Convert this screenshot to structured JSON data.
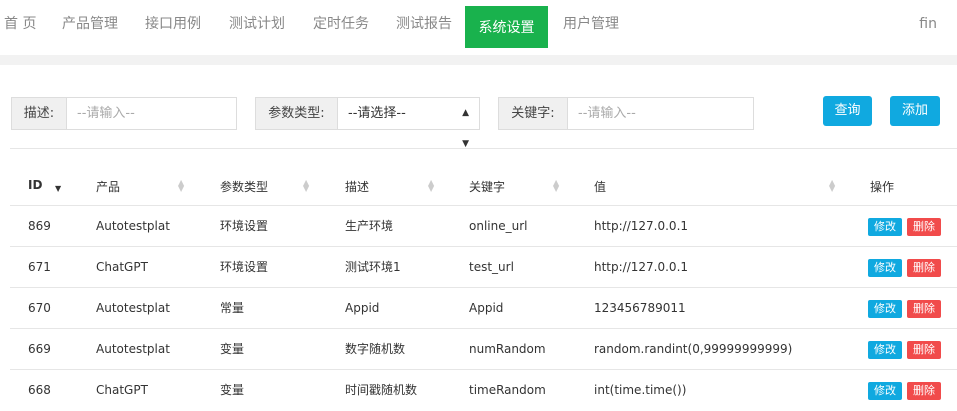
{
  "nav": {
    "items": [
      "首 页",
      "产品管理",
      "接口用例",
      "测试计划",
      "定时任务",
      "测试报告",
      "系统设置",
      "用户管理"
    ],
    "active": "系统设置",
    "user": "fin",
    "accent": "#19b24d"
  },
  "filters": {
    "desc_label": "描述:",
    "desc_placeholder": "--请输入--",
    "type_label": "参数类型:",
    "type_value": "--请选择--",
    "keyword_label": "关键字:",
    "keyword_placeholder": "--请输入--",
    "query_button": "查询",
    "add_button": "添加",
    "button_color": "#10a9e0"
  },
  "table": {
    "headers": [
      "ID",
      "产品",
      "参数类型",
      "描述",
      "关键字",
      "值",
      "操作"
    ],
    "edit_label": "修改",
    "delete_label": "删除",
    "rows": [
      {
        "id": "869",
        "product": "Autotestplat",
        "type": "环境设置",
        "desc": "生产环境",
        "keyword": "online_url",
        "value": "http://127.0.0.1"
      },
      {
        "id": "671",
        "product": "ChatGPT",
        "type": "环境设置",
        "desc": "测试环境1",
        "keyword": "test_url",
        "value": "http://127.0.0.1"
      },
      {
        "id": "670",
        "product": "Autotestplat",
        "type": "常量",
        "desc": "Appid",
        "keyword": "Appid",
        "value": "123456789011"
      },
      {
        "id": "669",
        "product": "Autotestplat",
        "type": "变量",
        "desc": "数字随机数",
        "keyword": "numRandom",
        "value": "random.randint(0,99999999999)"
      },
      {
        "id": "668",
        "product": "ChatGPT",
        "type": "变量",
        "desc": "时间戳随机数",
        "keyword": "timeRandom",
        "value": "int(time.time())"
      }
    ]
  }
}
